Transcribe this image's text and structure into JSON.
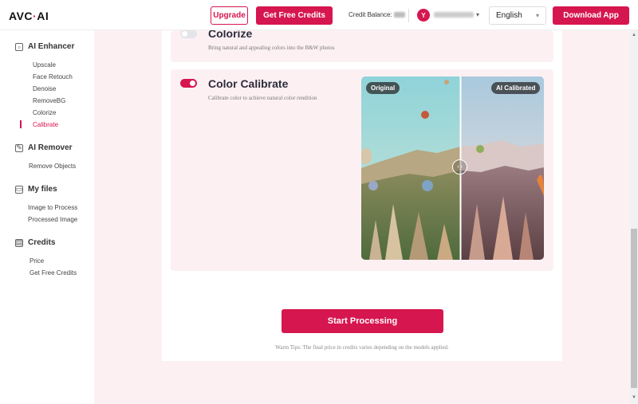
{
  "header": {
    "logo_main": "AVC",
    "logo_dot": "·",
    "logo_suffix": "AI",
    "upgrade": "Upgrade",
    "get_free_credits": "Get Free Credits",
    "credit_balance_label": "Credit Balance:",
    "avatar_letter": "Y",
    "language": "English",
    "download_app": "Download App"
  },
  "sidebar": {
    "enhancer": {
      "title": "AI Enhancer",
      "items": [
        "Upscale",
        "Face Retouch",
        "Denoise",
        "RemoveBG",
        "Colorize",
        "Calibrate"
      ]
    },
    "remover": {
      "title": "AI Remover",
      "items": [
        "Remove Objects"
      ]
    },
    "files": {
      "title": "My files",
      "items": [
        "Image to Process",
        "Processed Image"
      ]
    },
    "credits": {
      "title": "Credits",
      "items": [
        "Price",
        "Get Free Credits"
      ]
    },
    "active_item": "Calibrate"
  },
  "features": {
    "colorize": {
      "title": "Colorize",
      "desc": "Bring natural and appealing colors into the B&W photos",
      "enabled": false
    },
    "calibrate": {
      "title": "Color Calibrate",
      "desc": "Calibrate color to achieve natural color rendition",
      "enabled": true
    }
  },
  "compare": {
    "left_label": "Original",
    "right_label": "AI Calibrated",
    "handle_icon": "‹ ›"
  },
  "actions": {
    "start": "Start Processing",
    "tips": "Warm Tips: The final price in credits varies depending on the models applied."
  },
  "colors": {
    "accent": "#d6164f",
    "background": "#fdf0f3"
  },
  "icons": {
    "enhancer": "image-icon",
    "remover": "eraser-icon",
    "files": "folder-icon",
    "credits": "wallet-icon"
  }
}
